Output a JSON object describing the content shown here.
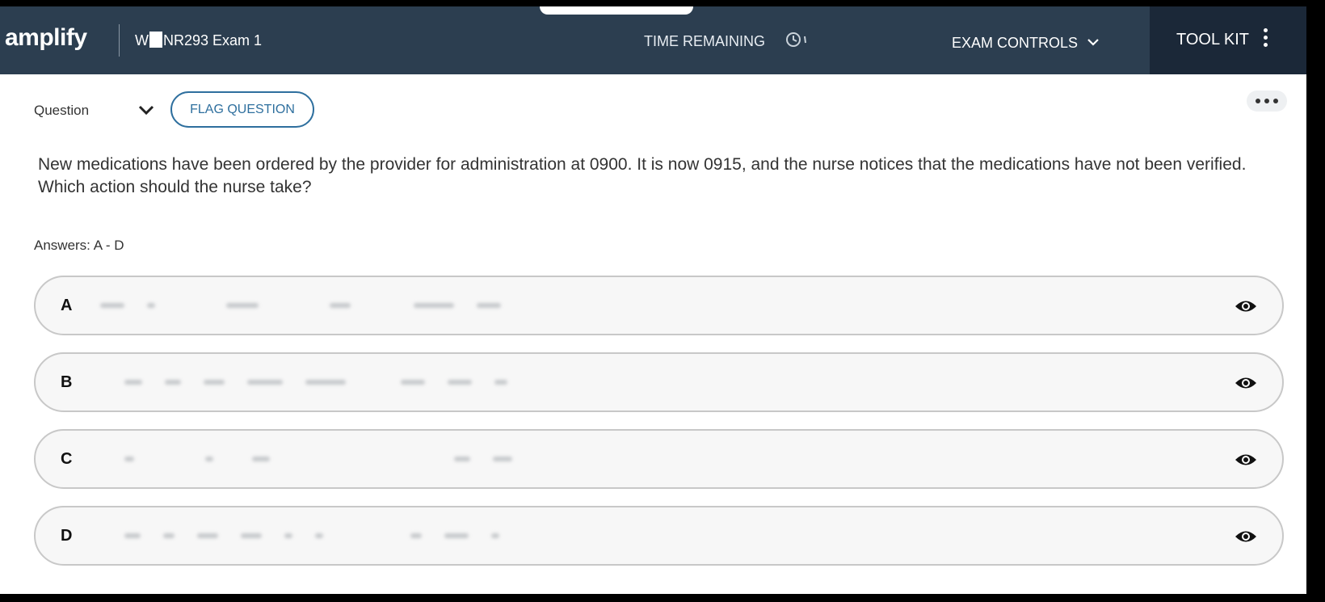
{
  "header": {
    "logo": "amplify",
    "exam_prefix": "W",
    "exam_suffix": "NR293 Exam 1",
    "time_remaining_label": "TIME REMAINING",
    "exam_controls_label": "EXAM CONTROLS",
    "toolkit_label": "TOOL KIT"
  },
  "question": {
    "label": "Question",
    "number": "",
    "flag_label": "FLAG QUESTION",
    "stem": "New medications have been ordered by the provider for administration at 0900. It is now 0915, and the nurse notices that the medications have not been verified.  Which action should the nurse take?",
    "answers_label": "Answers: A - D"
  },
  "options": [
    {
      "letter": "A"
    },
    {
      "letter": "B"
    },
    {
      "letter": "C"
    },
    {
      "letter": "D"
    }
  ],
  "colors": {
    "header_bg": "#2c3e50",
    "toolkit_bg": "#1b2838",
    "accent": "#2e6f9e"
  },
  "icons": {
    "exam_controls": "chevron-down-icon",
    "toolkit": "kebab-icon",
    "question_nav": "chevron-down-icon",
    "more": "more-horizontal-icon",
    "option_reveal": "eye-icon"
  }
}
